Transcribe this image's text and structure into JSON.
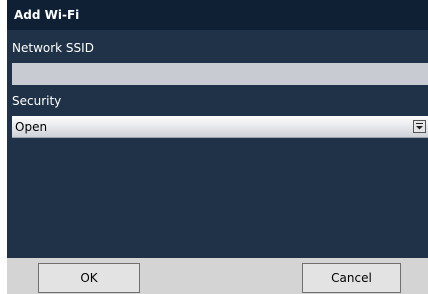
{
  "dialog": {
    "title": "Add Wi-Fi"
  },
  "form": {
    "ssid_label": "Network SSID",
    "ssid_value": "",
    "security_label": "Security",
    "security_selected": "Open"
  },
  "buttons": {
    "ok_label": "OK",
    "cancel_label": "Cancel"
  },
  "colors": {
    "title_bar": "#0f2035",
    "dialog_body": "#1f3247",
    "footer": "#d4d4d4"
  },
  "icons": {
    "dropdown": "chevron-down-icon"
  }
}
